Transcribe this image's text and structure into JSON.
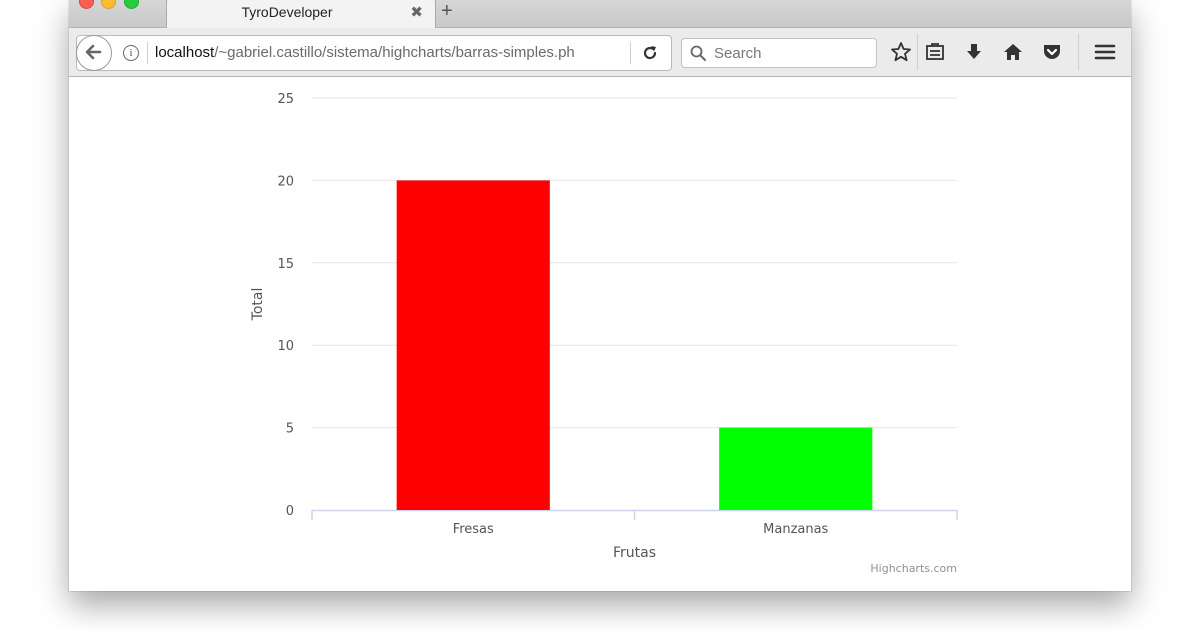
{
  "browser": {
    "tab_title": "TyroDeveloper",
    "tab_close": "✖",
    "new_tab": "+",
    "url_host": "localhost",
    "url_path": "/~gabriel.castillo/sistema/highcharts/barras-simples.ph",
    "search_placeholder": "Search"
  },
  "icons": {
    "back": "back-arrow-icon",
    "info": "info-icon",
    "reload": "reload-icon",
    "search": "search-icon",
    "bookmark": "star-icon",
    "reading_list": "clipboard-icon",
    "downloads": "download-arrow-icon",
    "home": "home-icon",
    "pocket": "pocket-icon",
    "menu": "hamburger-menu-icon"
  },
  "chart_data": {
    "type": "bar",
    "title": "",
    "categories": [
      "Fresas",
      "Manzanas"
    ],
    "values": [
      20,
      5
    ],
    "colors": [
      "#ff0000",
      "#00ff00"
    ],
    "xlabel": "Frutas",
    "ylabel": "Total",
    "ylim": [
      0,
      25
    ],
    "yticks": [
      "0",
      "5",
      "10",
      "15",
      "20",
      "25"
    ],
    "grid": true,
    "legend": "none",
    "credits": "Highcharts.com"
  }
}
